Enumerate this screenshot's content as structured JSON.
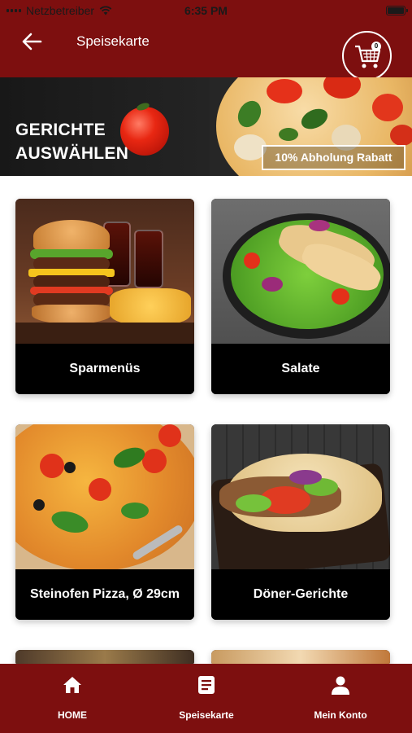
{
  "status_bar": {
    "carrier": "Netzbetreiber",
    "time": "6:35 PM"
  },
  "header": {
    "title": "Speisekarte",
    "cart_count": "0"
  },
  "banner": {
    "heading_line1": "GERICHTE",
    "heading_line2": "AUSWÄHLEN",
    "promo": "10% Abholung Rabatt"
  },
  "categories": [
    {
      "label": "Sparmenüs"
    },
    {
      "label": "Salate"
    },
    {
      "label": "Steinofen Pizza, Ø 29cm"
    },
    {
      "label": "Döner-Gerichte"
    }
  ],
  "bottom_nav": {
    "items": [
      {
        "label": "HOME",
        "icon": "home-icon"
      },
      {
        "label": "Speisekarte",
        "icon": "menu-list-icon"
      },
      {
        "label": "Mein Konto",
        "icon": "user-icon"
      }
    ]
  },
  "colors": {
    "brand": "#7d0f0f",
    "card_label_bg": "#000000",
    "text_on_brand": "#ffffff"
  }
}
